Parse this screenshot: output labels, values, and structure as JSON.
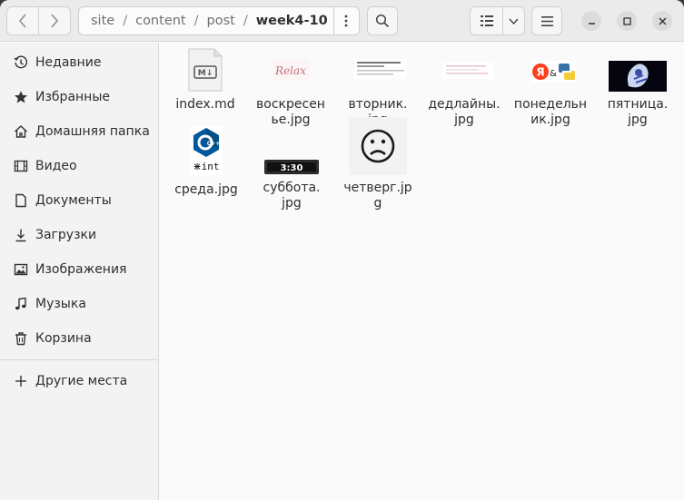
{
  "header": {
    "path": [
      "site",
      "content",
      "post",
      "week4-10"
    ],
    "separator": "/"
  },
  "icons": {
    "back": "chevron-left-icon",
    "forward": "chevron-right-icon",
    "path_menu": "vertical-ellipsis-icon",
    "search": "search-icon",
    "view": "list-view-icon",
    "view_options": "chevron-down-icon",
    "menu": "hamburger-menu-icon",
    "minimize": "minimize-icon",
    "maximize": "maximize-icon",
    "close": "close-icon"
  },
  "sidebar": {
    "items": [
      {
        "label": "Недавние",
        "icon": "clock-icon"
      },
      {
        "label": "Избранные",
        "icon": "star-icon"
      },
      {
        "label": "Домашняя папка",
        "icon": "home-icon"
      },
      {
        "label": "Видео",
        "icon": "film-icon"
      },
      {
        "label": "Документы",
        "icon": "document-icon"
      },
      {
        "label": "Загрузки",
        "icon": "download-icon"
      },
      {
        "label": "Изображения",
        "icon": "image-icon"
      },
      {
        "label": "Музыка",
        "icon": "music-icon"
      },
      {
        "label": "Корзина",
        "icon": "trash-icon"
      }
    ],
    "other": {
      "label": "Другие места",
      "icon": "plus-icon"
    }
  },
  "files": [
    {
      "line1": "index.md",
      "line2": ""
    },
    {
      "line1": "воскресен",
      "line2": "ье.jpg"
    },
    {
      "line1": "вторник.",
      "line2": "jpg"
    },
    {
      "line1": "дедлайны.",
      "line2": "jpg"
    },
    {
      "line1": "понедельн",
      "line2": "ик.jpg"
    },
    {
      "line1": "пятница.",
      "line2": "jpg"
    },
    {
      "line1": "среда.jpg",
      "line2": ""
    },
    {
      "line1": "суббота.",
      "line2": "jpg"
    },
    {
      "line1": "четверг.jpg",
      "line2": ""
    }
  ],
  "thumb_text": {
    "markdown": "M↓",
    "relax": "Relax",
    "yandex": "Я",
    "ampersand": "&",
    "cpp": "C++",
    "int_caption": "⋇int",
    "clock": "3:30"
  }
}
